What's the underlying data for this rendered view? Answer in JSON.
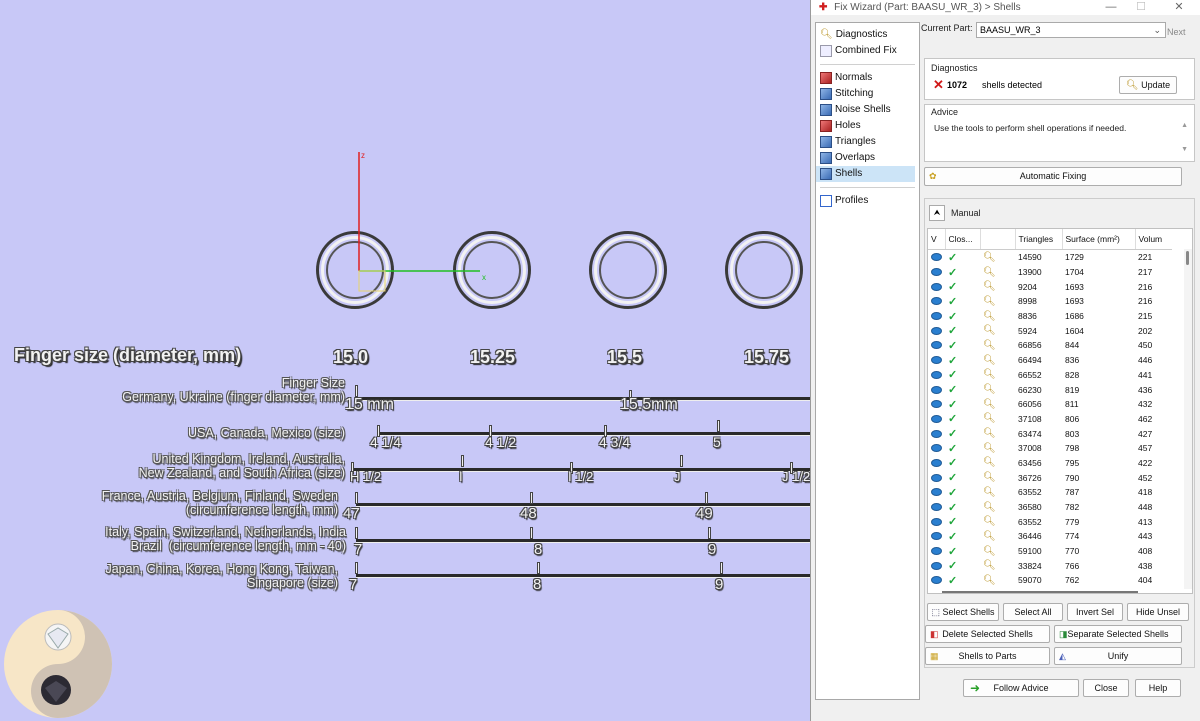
{
  "viewport": {
    "axis_z": "z",
    "axis_x": "x",
    "finger_size_title": "Finger size (diameter, mm)",
    "sizes": [
      "15.0",
      "15.25",
      "15.5",
      "15.75"
    ],
    "rows": [
      {
        "label": "Finger Size\nGermany, Ukraine (finger diameter, mm)",
        "ticks": [
          "15 mm",
          "15.5mm"
        ]
      },
      {
        "label": "USA, Canada, Mexico (size)",
        "ticks": [
          "4 1/4",
          "4 1/2",
          "4 3/4",
          "5"
        ]
      },
      {
        "label": "United Kingdom, Ireland, Australia,\nNew Zealand, and South Africa (size)",
        "ticks": [
          "H 1/2",
          "I",
          "I 1/2",
          "J",
          "J 1/2"
        ]
      },
      {
        "label": "France, Austria, Belgium, Finland, Sweden\n(circumference length, mm)",
        "ticks": [
          "47",
          "48",
          "49"
        ]
      },
      {
        "label": "Italy, Spain, Switzerland, Netherlands, India\nBrazil  (circumference length, mm - 40)",
        "ticks": [
          "7",
          "8",
          "9"
        ]
      },
      {
        "label": "Japan, China, Korea, Hong Kong, Taiwan,\nSingapore (size)",
        "ticks": [
          "7",
          "8",
          "9"
        ]
      }
    ]
  },
  "wizard": {
    "title": "Fix Wizard (Part: BAASU_WR_3) > Shells",
    "controls": {
      "minimize": "—",
      "maximize": "☐",
      "close": "✕"
    },
    "current_part_label": "Current Part:",
    "current_part_value": "BAASU_WR_3",
    "next_label": "Next",
    "nav": {
      "top": [
        "Diagnostics",
        "Combined Fix"
      ],
      "tools": [
        "Normals",
        "Stitching",
        "Noise Shells",
        "Holes",
        "Triangles",
        "Overlaps",
        "Shells"
      ],
      "bottom": [
        "Profiles"
      ],
      "active": "Shells"
    },
    "diagnostics": {
      "label": "Diagnostics",
      "count": "1072",
      "text": "shells detected",
      "update": "Update"
    },
    "advice": {
      "label": "Advice",
      "text": "Use the tools to perform shell operations if needed."
    },
    "automatic_fixing": "Automatic Fixing",
    "manual_label": "Manual",
    "table": {
      "columns": [
        "V",
        "Clos...",
        "",
        "Triangles",
        "Surface (mm²)",
        "Volum"
      ],
      "rows": [
        [
          "14590",
          "1729",
          "221"
        ],
        [
          "13900",
          "1704",
          "217"
        ],
        [
          "9204",
          "1693",
          "216"
        ],
        [
          "8998",
          "1693",
          "216"
        ],
        [
          "8836",
          "1686",
          "215"
        ],
        [
          "5924",
          "1604",
          "202"
        ],
        [
          "66856",
          "844",
          "450"
        ],
        [
          "66494",
          "836",
          "446"
        ],
        [
          "66552",
          "828",
          "441"
        ],
        [
          "66230",
          "819",
          "436"
        ],
        [
          "66056",
          "811",
          "432"
        ],
        [
          "37108",
          "806",
          "462"
        ],
        [
          "63474",
          "803",
          "427"
        ],
        [
          "37008",
          "798",
          "457"
        ],
        [
          "63456",
          "795",
          "422"
        ],
        [
          "36726",
          "790",
          "452"
        ],
        [
          "63552",
          "787",
          "418"
        ],
        [
          "36580",
          "782",
          "448"
        ],
        [
          "63552",
          "779",
          "413"
        ],
        [
          "36446",
          "774",
          "443"
        ],
        [
          "59100",
          "770",
          "408"
        ],
        [
          "33824",
          "766",
          "438"
        ],
        [
          "59070",
          "762",
          "404"
        ]
      ]
    },
    "buttons": {
      "select_shells": "Select Shells",
      "select_all": "Select All",
      "invert_sel": "Invert Sel",
      "hide_unsel": "Hide Unsel",
      "delete_selected": "Delete Selected Shells",
      "separate_selected": "Separate Selected Shells",
      "shells_to_parts": "Shells to Parts",
      "unify": "Unify",
      "follow_advice": "Follow Advice",
      "close": "Close",
      "help": "Help"
    }
  }
}
